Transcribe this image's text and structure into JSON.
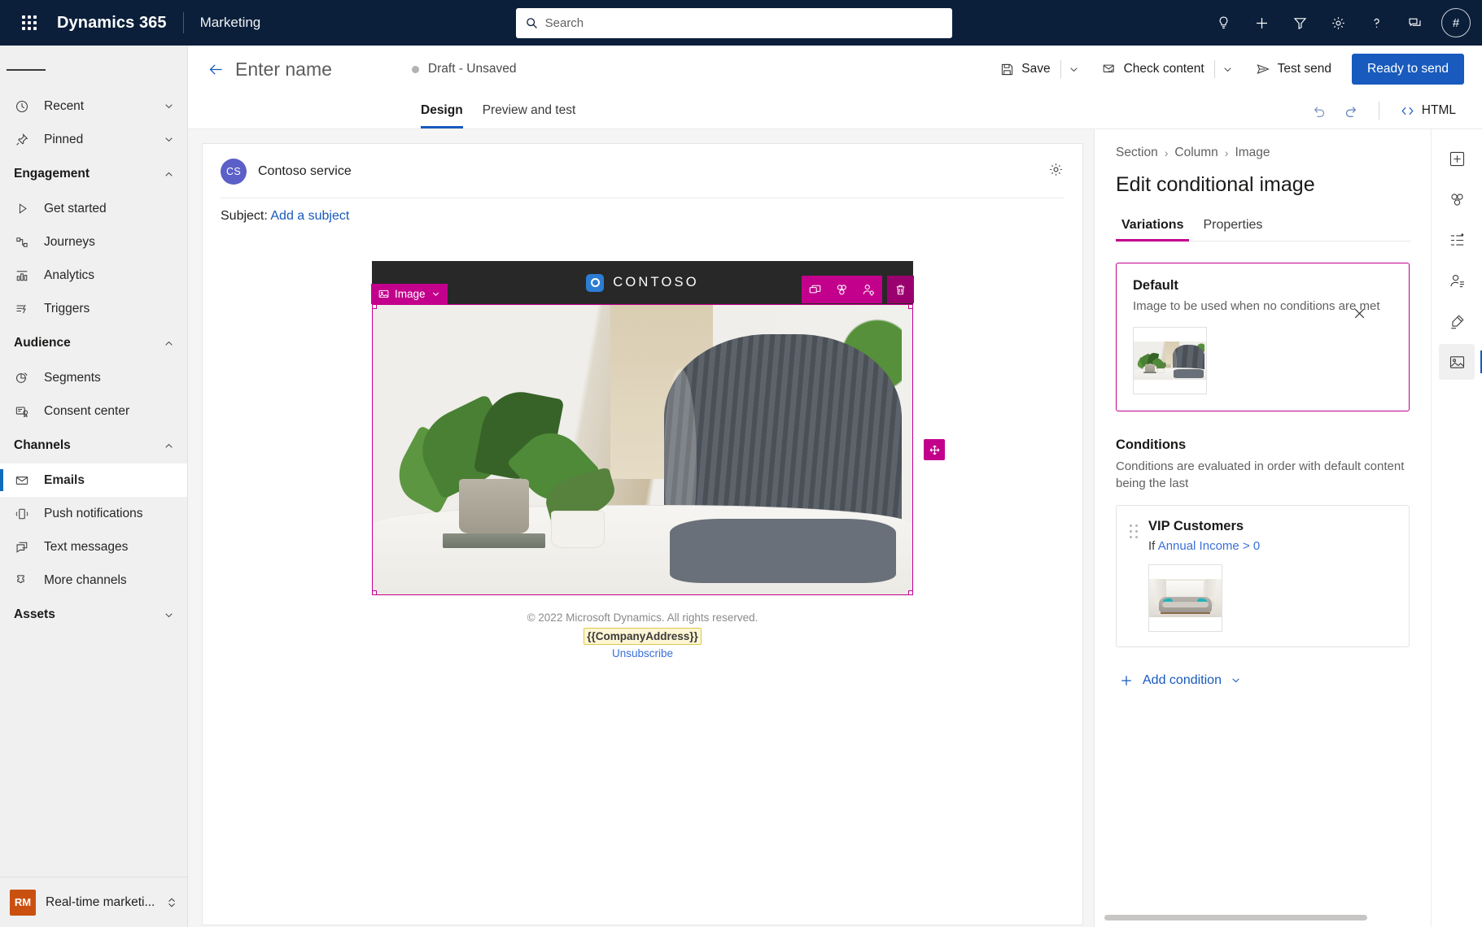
{
  "topbar": {
    "waffle_label": "app-launcher",
    "brand": "Dynamics 365",
    "app_name": "Marketing",
    "search_placeholder": "Search",
    "icons": [
      {
        "name": "lightbulb-icon",
        "label": "Insights"
      },
      {
        "name": "plus-icon",
        "label": "New"
      },
      {
        "name": "filter-icon",
        "label": "Filter"
      },
      {
        "name": "gear-icon",
        "label": "Settings"
      },
      {
        "name": "help-icon",
        "label": "Help"
      },
      {
        "name": "feedback-icon",
        "label": "Feedback"
      }
    ],
    "avatar_initials": "#"
  },
  "sidebar": {
    "hamburger_label": "menu",
    "items": [
      {
        "label": "Recent",
        "icon": "clock-icon",
        "type": "item",
        "chevron": "down"
      },
      {
        "label": "Pinned",
        "icon": "pin-icon",
        "type": "item",
        "chevron": "down"
      },
      {
        "label": "Engagement",
        "type": "group",
        "chevron": "up"
      },
      {
        "label": "Get started",
        "icon": "play-icon",
        "type": "item"
      },
      {
        "label": "Journeys",
        "icon": "journeys-icon",
        "type": "item"
      },
      {
        "label": "Analytics",
        "icon": "analytics-icon",
        "type": "item"
      },
      {
        "label": "Triggers",
        "icon": "triggers-icon",
        "type": "item"
      },
      {
        "label": "Audience",
        "type": "group",
        "chevron": "up"
      },
      {
        "label": "Segments",
        "icon": "segments-icon",
        "type": "item"
      },
      {
        "label": "Consent center",
        "icon": "consent-icon",
        "type": "item"
      },
      {
        "label": "Channels",
        "type": "group",
        "chevron": "up"
      },
      {
        "label": "Emails",
        "icon": "email-icon",
        "type": "item",
        "selected": true
      },
      {
        "label": "Push notifications",
        "icon": "push-icon",
        "type": "item"
      },
      {
        "label": "Text messages",
        "icon": "sms-icon",
        "type": "item"
      },
      {
        "label": "More channels",
        "icon": "more-channels-icon",
        "type": "item"
      },
      {
        "label": "Assets",
        "type": "group",
        "chevron": "down"
      }
    ],
    "area_switcher": {
      "badge": "RM",
      "label": "Real-time marketi...",
      "icon": "updown-chevron-icon"
    }
  },
  "command_bar": {
    "back_label": "back-arrow",
    "record_name": "Enter name",
    "status": "Draft - Unsaved",
    "save_label": "Save",
    "check_content_label": "Check content",
    "test_send_label": "Test send",
    "primary_label": "Ready to send"
  },
  "tabbar": {
    "tabs": [
      {
        "label": "Design",
        "active": true
      },
      {
        "label": "Preview and test",
        "active": false
      }
    ],
    "undo_label": "undo-icon",
    "redo_label": "redo-icon",
    "html_label": "HTML"
  },
  "email": {
    "sender_initials": "CS",
    "sender_name": "Contoso service",
    "subject_label": "Subject:",
    "subject_link": "Add a subject",
    "settings_icon": "gear-icon",
    "banner_brand": "CONTOSO",
    "block_toolbar": {
      "type_label": "Image",
      "type_caret": "chevron-down-icon",
      "actions": [
        {
          "name": "duplicate-block-icon"
        },
        {
          "name": "conditional-content-icon"
        },
        {
          "name": "personalization-icon"
        },
        {
          "name": "delete-block-icon"
        }
      ],
      "drag_label": "move-block-handle"
    },
    "footer": {
      "copyright": "© 2022 Microsoft Dynamics. All rights reserved.",
      "address_token": "{{CompanyAddress}}",
      "unsubscribe": "Unsubscribe"
    }
  },
  "panel": {
    "breadcrumb": [
      "Section",
      "Column",
      "Image"
    ],
    "close_label": "close-icon",
    "title": "Edit conditional image",
    "tabs": [
      {
        "label": "Variations",
        "active": true
      },
      {
        "label": "Properties",
        "active": false
      }
    ],
    "default": {
      "title": "Default",
      "subtitle": "Image to be used when no conditions are met",
      "thumb_name": "default-variation-thumbnail"
    },
    "conditions": {
      "title": "Conditions",
      "subtitle": "Conditions are evaluated in order with default content being the last",
      "items": [
        {
          "name": "VIP Customers",
          "if_prefix": "If",
          "field": "Annual Income",
          "operator": ">",
          "value": "0",
          "thumb_name": "vip-variation-thumbnail"
        }
      ],
      "add_label": "Add condition",
      "add_caret": "chevron-down-icon"
    }
  },
  "rail": {
    "items": [
      {
        "name": "rail-add-element",
        "active": false
      },
      {
        "name": "rail-templates",
        "active": false
      },
      {
        "name": "rail-structure",
        "active": false
      },
      {
        "name": "rail-personalization",
        "active": false
      },
      {
        "name": "rail-brand",
        "active": false
      },
      {
        "name": "rail-images",
        "active": true
      }
    ]
  },
  "colors": {
    "topbar_bg": "#0b1f3a",
    "accent_blue": "#185abd",
    "block_magenta": "#c3008c",
    "sidebar_bg": "#f0f0f0",
    "rm_badge": "#ca5010"
  }
}
